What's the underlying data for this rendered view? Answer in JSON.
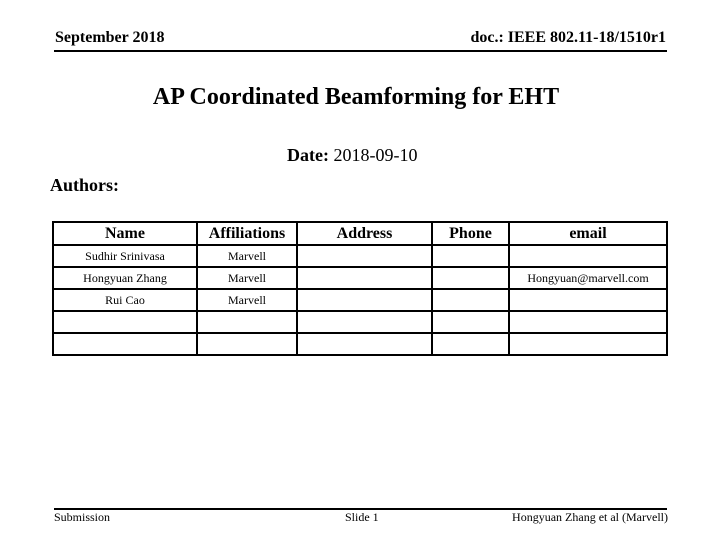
{
  "header": {
    "date": "September 2018",
    "doc_id": "doc.: IEEE 802.11-18/1510r1"
  },
  "title": "AP Coordinated Beamforming for EHT",
  "date_line": {
    "label": "Date:",
    "value": "2018-09-10"
  },
  "authors_label": "Authors:",
  "authors_table": {
    "columns": [
      "Name",
      "Affiliations",
      "Address",
      "Phone",
      "email"
    ],
    "rows": [
      [
        "Sudhir Srinivasa",
        "Marvell",
        "",
        "",
        ""
      ],
      [
        "Hongyuan Zhang",
        "Marvell",
        "",
        "",
        "Hongyuan@marvell.com"
      ],
      [
        "Rui Cao",
        "Marvell",
        "",
        "",
        ""
      ],
      [
        "",
        "",
        "",
        "",
        ""
      ],
      [
        "",
        "",
        "",
        "",
        ""
      ]
    ]
  },
  "footer": {
    "left": "Submission",
    "center": "Slide 1",
    "right": "Hongyuan Zhang et al (Marvell)"
  }
}
